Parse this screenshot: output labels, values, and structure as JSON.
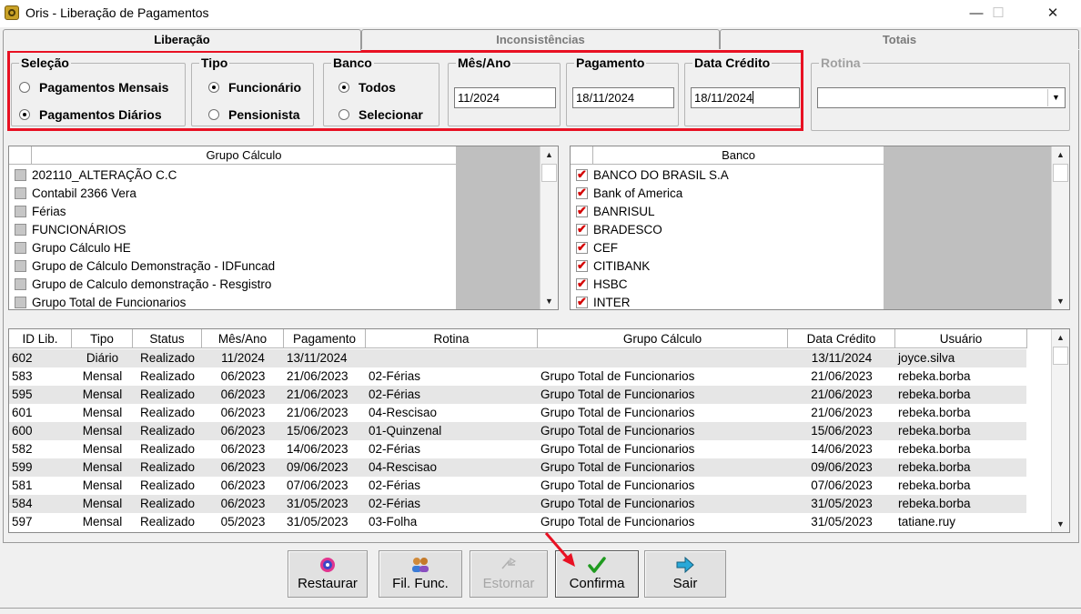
{
  "window": {
    "title": "Oris - Liberação de Pagamentos",
    "minimize": "—",
    "maximize": "☐",
    "close": "✕"
  },
  "tabs": [
    {
      "label": "Liberação",
      "active": true
    },
    {
      "label": "Inconsistências",
      "active": false
    },
    {
      "label": "Totais",
      "active": false
    }
  ],
  "filters": {
    "selecao": {
      "title": "Seleção",
      "options": [
        "Pagamentos Mensais",
        "Pagamentos Diários"
      ],
      "selected": 1
    },
    "tipo": {
      "title": "Tipo",
      "options": [
        "Funcionário",
        "Pensionista"
      ],
      "selected": 0
    },
    "banco": {
      "title": "Banco",
      "options": [
        "Todos",
        "Selecionar"
      ],
      "selected": 0
    },
    "mes_ano": {
      "title": "Mês/Ano",
      "value": "11/2024"
    },
    "pagamento": {
      "title": "Pagamento",
      "value": "18/11/2024"
    },
    "data_credito": {
      "title": "Data Crédito",
      "value": "18/11/2024"
    },
    "rotina": {
      "title": "Rotina",
      "value": ""
    }
  },
  "grupo_list": {
    "header": "Grupo Cálculo",
    "items": [
      "202110_ALTERAÇÃO C.C",
      "Contabil 2366 Vera",
      "Férias",
      "FUNCIONÁRIOS",
      "Grupo Cálculo HE",
      "Grupo de Cálculo Demonstração - IDFuncad",
      "Grupo de Calculo demonstração - Resgistro",
      "Grupo Total de Funcionarios"
    ]
  },
  "banco_list": {
    "header": "Banco",
    "items": [
      "BANCO DO BRASIL S.A",
      "Bank of America",
      "BANRISUL",
      "BRADESCO",
      "CEF",
      "CITIBANK",
      "HSBC",
      "INTER"
    ]
  },
  "grid": {
    "columns": [
      "ID Lib.",
      "Tipo",
      "Status",
      "Mês/Ano",
      "Pagamento",
      "Rotina",
      "Grupo Cálculo",
      "Data Crédito",
      "Usuário"
    ],
    "rows": [
      [
        "602",
        "Diário",
        "Realizado",
        "11/2024",
        "13/11/2024",
        "",
        "",
        "13/11/2024",
        "joyce.silva"
      ],
      [
        "583",
        "Mensal",
        "Realizado",
        "06/2023",
        "21/06/2023",
        "02-Férias",
        "Grupo Total de Funcionarios",
        "21/06/2023",
        "rebeka.borba"
      ],
      [
        "595",
        "Mensal",
        "Realizado",
        "06/2023",
        "21/06/2023",
        "02-Férias",
        "Grupo Total de Funcionarios",
        "21/06/2023",
        "rebeka.borba"
      ],
      [
        "601",
        "Mensal",
        "Realizado",
        "06/2023",
        "21/06/2023",
        "04-Rescisao",
        "Grupo Total de Funcionarios",
        "21/06/2023",
        "rebeka.borba"
      ],
      [
        "600",
        "Mensal",
        "Realizado",
        "06/2023",
        "15/06/2023",
        "01-Quinzenal",
        "Grupo Total de Funcionarios",
        "15/06/2023",
        "rebeka.borba"
      ],
      [
        "582",
        "Mensal",
        "Realizado",
        "06/2023",
        "14/06/2023",
        "02-Férias",
        "Grupo Total de Funcionarios",
        "14/06/2023",
        "rebeka.borba"
      ],
      [
        "599",
        "Mensal",
        "Realizado",
        "06/2023",
        "09/06/2023",
        "04-Rescisao",
        "Grupo Total de Funcionarios",
        "09/06/2023",
        "rebeka.borba"
      ],
      [
        "581",
        "Mensal",
        "Realizado",
        "06/2023",
        "07/06/2023",
        "02-Férias",
        "Grupo Total de Funcionarios",
        "07/06/2023",
        "rebeka.borba"
      ],
      [
        "584",
        "Mensal",
        "Realizado",
        "06/2023",
        "31/05/2023",
        "02-Férias",
        "Grupo Total de Funcionarios",
        "31/05/2023",
        "rebeka.borba"
      ],
      [
        "597",
        "Mensal",
        "Realizado",
        "05/2023",
        "31/05/2023",
        "03-Folha",
        "Grupo Total de Funcionarios",
        "31/05/2023",
        "tatiane.ruy"
      ]
    ]
  },
  "buttons": {
    "restaurar": "Restaurar",
    "fil_func": "Fil. Func.",
    "estornar": "Estornar",
    "confirma": "Confirma",
    "sair": "Sair"
  },
  "colors": {
    "highlight": "#e81123",
    "check": "#d40000"
  }
}
